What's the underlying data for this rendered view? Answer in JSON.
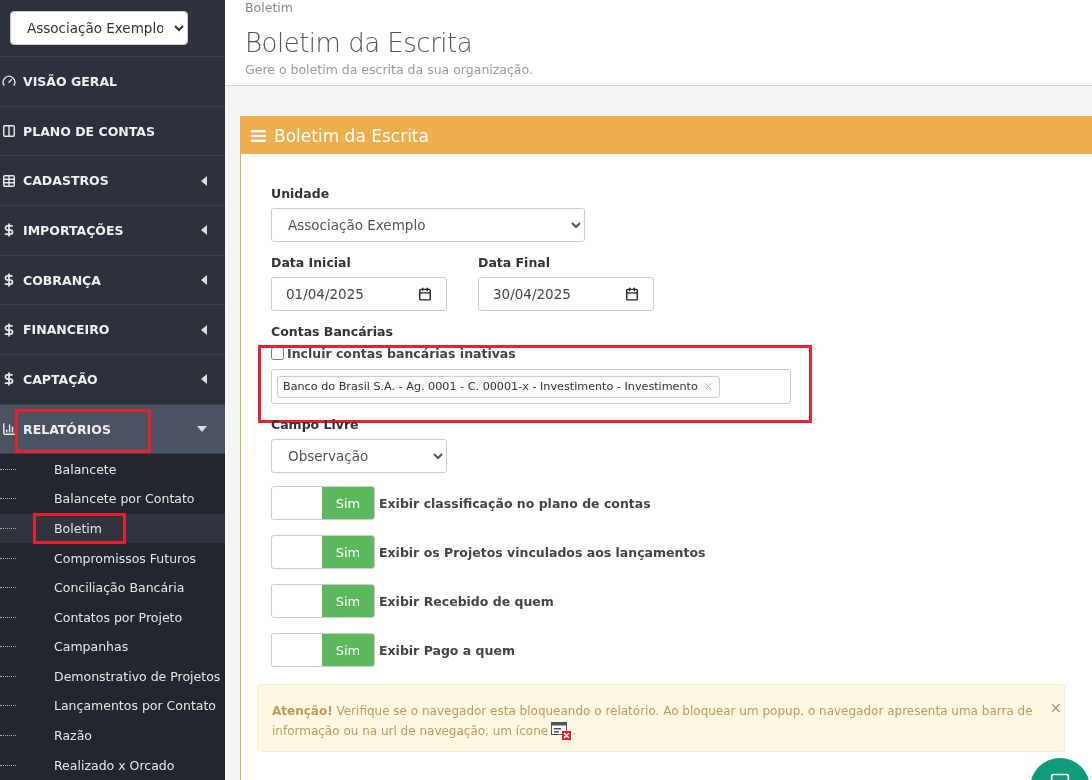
{
  "sidebar": {
    "organization_select": "Associação Exemplo",
    "items": [
      {
        "label": "VISÃO GERAL",
        "selected": false,
        "highlighted": false
      },
      {
        "label": "PLANO DE CONTAS",
        "selected": false,
        "highlighted": false
      },
      {
        "label": "CADASTROS",
        "expanded": false,
        "selected": false,
        "highlighted": false
      },
      {
        "label": "IMPORTAÇÕES",
        "expanded": false,
        "selected": false,
        "highlighted": false
      },
      {
        "label": "COBRANÇA",
        "expanded": false,
        "selected": false,
        "highlighted": false
      },
      {
        "label": "FINANCEIRO",
        "expanded": false,
        "selected": false,
        "highlighted": false
      },
      {
        "label": "CAPTAÇÃO",
        "expanded": false,
        "selected": false,
        "highlighted": false
      },
      {
        "label": "RELATÓRIOS",
        "expanded": true,
        "selected": true,
        "highlighted": true,
        "children": [
          {
            "label": "Balancete",
            "selected": false,
            "highlighted": false
          },
          {
            "label": "Balancete por Contato",
            "selected": false,
            "highlighted": false
          },
          {
            "label": "Boletim",
            "selected": true,
            "highlighted": true
          },
          {
            "label": "Compromissos Futuros",
            "selected": false,
            "highlighted": false
          },
          {
            "label": "Conciliação Bancária",
            "selected": false,
            "highlighted": false
          },
          {
            "label": "Contatos por Projeto",
            "selected": false,
            "highlighted": false
          },
          {
            "label": "Campanhas",
            "selected": false,
            "highlighted": false
          },
          {
            "label": "Demonstrativo de Projetos",
            "selected": false,
            "highlighted": false
          },
          {
            "label": "Lançamentos por Contato",
            "selected": false,
            "highlighted": false
          },
          {
            "label": "Razão",
            "selected": false,
            "highlighted": false
          },
          {
            "label": "Realizado x Orcado",
            "selected": false,
            "highlighted": false
          }
        ]
      }
    ]
  },
  "header": {
    "breadcrumb": "Boletim",
    "title": "Boletim da Escrita",
    "subtitle": "Gere o boletim da escrita da sua organização."
  },
  "panel": {
    "title": "Boletim da Escrita",
    "unit": {
      "label": "Unidade",
      "value": "Associação Exemplo"
    },
    "start_date": {
      "label": "Data Inicial",
      "value": "01/04/2025"
    },
    "end_date": {
      "label": "Data Final",
      "value": "30/04/2025"
    },
    "bank_accounts": {
      "label": "Contas Bancárias",
      "highlighted": true,
      "include_inactive": {
        "label": "Incluir contas bancárias inativas",
        "checked": false
      },
      "tags": [
        "Banco do Brasil S.A. - Ag. 0001 - C. 00001-x - Investimento - Investimento"
      ]
    },
    "free_field": {
      "label": "Campo Livre",
      "value": "Observação"
    },
    "toggles": [
      {
        "label": "Exibir classificação no plano de contas",
        "state_label": "Sim",
        "on": true
      },
      {
        "label": "Exibir os Projetos vinculados aos lançamentos",
        "state_label": "Sim",
        "on": true
      },
      {
        "label": "Exibir Recebido de quem",
        "state_label": "Sim",
        "on": true
      },
      {
        "label": "Exibir Pago a quem",
        "state_label": "Sim",
        "on": true
      }
    ],
    "alert": {
      "text": "**Atenção!** Verifique se o navegador esta bloqueando o relatório. Ao bloquear um popup, o navegador apresenta uma barra de",
      "text_continued": "informação ou na url de navegação, um ícone",
      "text_end": ".",
      "close": "×"
    }
  }
}
